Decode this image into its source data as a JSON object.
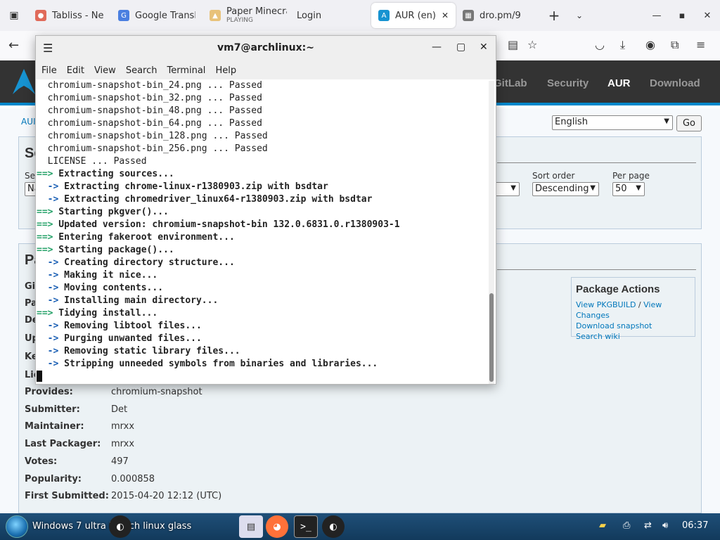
{
  "browser": {
    "tabs": [
      {
        "title": "Tabliss - New T",
        "active": false
      },
      {
        "title": "Google Transla",
        "active": false
      },
      {
        "title": "Paper Minecra",
        "subtitle": "PLAYING",
        "active": false
      },
      {
        "title": "Login",
        "active": false
      },
      {
        "title": "AUR (en) - c",
        "active": true
      },
      {
        "title": "dro.pm/9",
        "active": false
      }
    ],
    "new_tab": "+",
    "tab_list_menu": "⌄"
  },
  "arch": {
    "nav": [
      "GitLab",
      "Security",
      "AUR",
      "Download"
    ],
    "active_nav": "AUR",
    "breadcrumb": "AUI",
    "language": "English",
    "go_label": "Go",
    "search_box_title_fragment": "Se",
    "search_fields": {
      "field_label_fragment": "Sea",
      "field_value_fragment": "Na",
      "sort_order_label": "Sort order",
      "sort_order_value": "Descending",
      "per_page_label": "Per page",
      "per_page_value": "50"
    },
    "details_title_fragment": "Pa",
    "hidden_keys": [
      "Git",
      "Pa",
      "De",
      "Up",
      "Ke",
      "Lic"
    ],
    "details": [
      {
        "key": "Provides:",
        "value": "chromium-snapshot"
      },
      {
        "key": "Submitter:",
        "value": "Det"
      },
      {
        "key": "Maintainer:",
        "value": "mrxx"
      },
      {
        "key": "Last Packager:",
        "value": "mrxx"
      },
      {
        "key": "Votes:",
        "value": "497"
      },
      {
        "key": "Popularity:",
        "value": "0.000858"
      },
      {
        "key": "First Submitted:",
        "value": "2015-04-20 12:12 (UTC)"
      }
    ],
    "package_actions": {
      "title": "Package Actions",
      "view_pkgbuild": "View PKGBUILD",
      "separator": "/",
      "view_changes": "View Changes",
      "download_snapshot": "Download snapshot",
      "search_wiki": "Search wiki"
    }
  },
  "terminal": {
    "title": "vm7@archlinux:~",
    "menu": [
      "File",
      "Edit",
      "View",
      "Search",
      "Terminal",
      "Help"
    ],
    "lines": [
      {
        "prefix": "",
        "text": "  chromium-snapshot-bin_24.png ... Passed",
        "bold": false
      },
      {
        "prefix": "",
        "text": "  chromium-snapshot-bin_32.png ... Passed",
        "bold": false
      },
      {
        "prefix": "",
        "text": "  chromium-snapshot-bin_48.png ... Passed",
        "bold": false
      },
      {
        "prefix": "",
        "text": "  chromium-snapshot-bin_64.png ... Passed",
        "bold": false
      },
      {
        "prefix": "",
        "text": "  chromium-snapshot-bin_128.png ... Passed",
        "bold": false
      },
      {
        "prefix": "",
        "text": "  chromium-snapshot-bin_256.png ... Passed",
        "bold": false
      },
      {
        "prefix": "",
        "text": "  LICENSE ... Passed",
        "bold": false
      },
      {
        "prefix": "==>",
        "text": " Extracting sources...",
        "bold": true
      },
      {
        "prefix": "  ->",
        "text": " Extracting chrome-linux-r1380903.zip with bsdtar",
        "bold": true
      },
      {
        "prefix": "  ->",
        "text": " Extracting chromedriver_linux64-r1380903.zip with bsdtar",
        "bold": true
      },
      {
        "prefix": "==>",
        "text": " Starting pkgver()...",
        "bold": true
      },
      {
        "prefix": "==>",
        "text": " Updated version: chromium-snapshot-bin 132.0.6831.0.r1380903-1",
        "bold": true
      },
      {
        "prefix": "==>",
        "text": " Entering fakeroot environment...",
        "bold": true
      },
      {
        "prefix": "==>",
        "text": " Starting package()...",
        "bold": true
      },
      {
        "prefix": "  ->",
        "text": " Creating directory structure...",
        "bold": true
      },
      {
        "prefix": "  ->",
        "text": " Making it nice...",
        "bold": true
      },
      {
        "prefix": "  ->",
        "text": " Moving contents...",
        "bold": true
      },
      {
        "prefix": "  ->",
        "text": " Installing main directory...",
        "bold": true
      },
      {
        "prefix": "==>",
        "text": " Tidying install...",
        "bold": true
      },
      {
        "prefix": "  ->",
        "text": " Removing libtool files...",
        "bold": true
      },
      {
        "prefix": "  ->",
        "text": " Purging unwanted files...",
        "bold": true
      },
      {
        "prefix": "  ->",
        "text": " Removing static library files...",
        "bold": true
      },
      {
        "prefix": "  ->",
        "text": " Stripping unneeded symbols from binaries and libraries...",
        "bold": true
      }
    ],
    "colors": {
      "arrow_green": "#26a269",
      "arrow_blue": "#1a5fb4"
    }
  },
  "taskbar": {
    "window_title": "Windows 7 ultra L... rch linux glass",
    "clock": "06:37"
  },
  "colors": {
    "arch_header": "#333333",
    "arch_accent": "#0088cc",
    "link": "#0077bb",
    "taskbar": "#1f4f78"
  }
}
